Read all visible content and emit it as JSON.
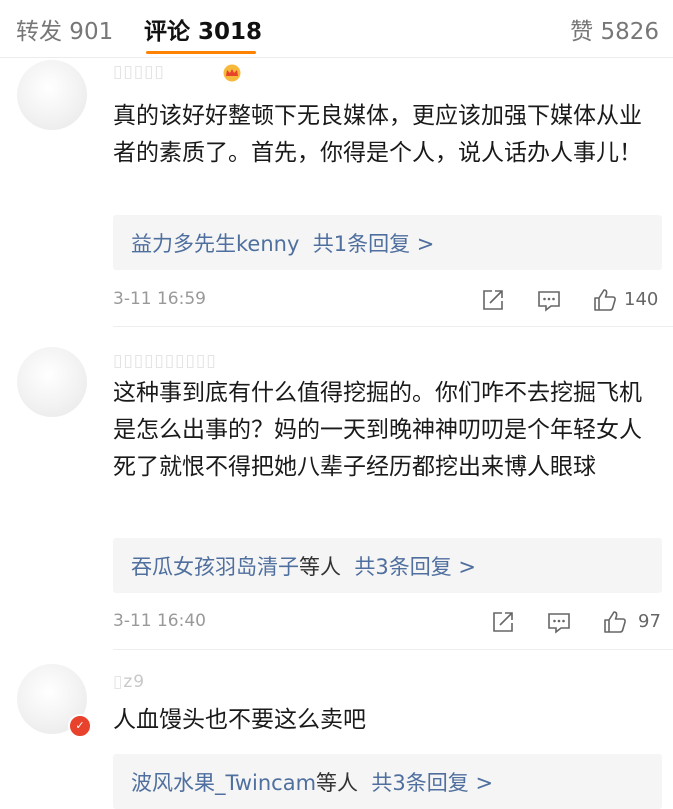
{
  "tabs": {
    "repost": "转发 901",
    "comment": "评论 3018",
    "like": "赞 5826"
  },
  "accent_color": "#ff8200",
  "comments": [
    {
      "text": "真的该好好整顿下无良媒体，更应该加强下媒体从业者的素质了。首先，你得是个人，说人话办人事儿！",
      "reply_users": "益力多先生kenny",
      "reply_suffix": "",
      "reply_count": "共1条回复 >",
      "time": "3-11 16:59",
      "likes": "140",
      "badge_icon": "crown-icon"
    },
    {
      "text": "这种事到底有什么值得挖掘的。你们咋不去挖掘飞机是怎么出事的？妈的一天到晚神神叨叨是个年轻女人死了就恨不得把她八辈子经历都挖出来博人眼球",
      "reply_users": "吞瓜女孩羽岛清子",
      "reply_suffix": "等人",
      "reply_count": "共3条回复 >",
      "time": "3-11 16:40",
      "likes": "97"
    },
    {
      "username": "z9",
      "text": "人血馒头也不要这么卖吧",
      "reply_users": "波风水果_Twincam",
      "reply_suffix": "等人",
      "reply_count": "共3条回复 >",
      "verified_icon": "verified-badge-icon"
    }
  ]
}
